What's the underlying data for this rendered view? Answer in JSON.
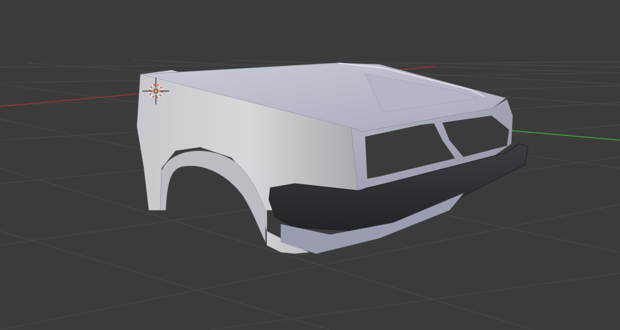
{
  "viewport": {
    "background": "#3b3b3b",
    "grid_color": "#4a4a4a",
    "x_axis_color": "#9a3a3a",
    "y_axis_color": "#3f9a3f"
  },
  "object": {
    "body_color": "#c7c9d6",
    "bumper_color": "#2e2f33"
  },
  "cursor": {
    "icon": "3d-cursor-icon",
    "ring_color": "#d84a3a"
  }
}
